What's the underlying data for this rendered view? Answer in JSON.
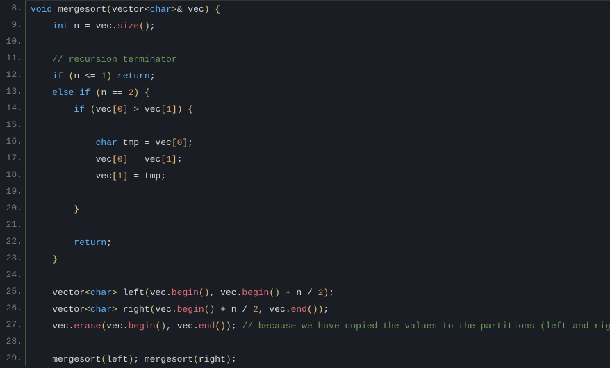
{
  "lines": [
    {
      "num": "8.",
      "tokens": [
        {
          "t": "void",
          "c": "blue"
        },
        {
          "t": " mergesort",
          "c": "plain"
        },
        {
          "t": "(",
          "c": "yellow"
        },
        {
          "t": "vector",
          "c": "plain"
        },
        {
          "t": "<",
          "c": "yellow"
        },
        {
          "t": "char",
          "c": "blue"
        },
        {
          "t": ">",
          "c": "yellow"
        },
        {
          "t": "& vec",
          "c": "plain"
        },
        {
          "t": ")",
          "c": "yellow"
        },
        {
          "t": " ",
          "c": "plain"
        },
        {
          "t": "{",
          "c": "yellow"
        }
      ]
    },
    {
      "num": "9.",
      "tokens": [
        {
          "t": "    ",
          "c": "plain"
        },
        {
          "t": "int",
          "c": "blue"
        },
        {
          "t": " n = vec.",
          "c": "plain"
        },
        {
          "t": "size",
          "c": "method"
        },
        {
          "t": "()",
          "c": "yellow"
        },
        {
          "t": ";",
          "c": "plain"
        }
      ]
    },
    {
      "num": "10.",
      "tokens": []
    },
    {
      "num": "11.",
      "tokens": [
        {
          "t": "    ",
          "c": "plain"
        },
        {
          "t": "// recursion terminator",
          "c": "comment"
        }
      ]
    },
    {
      "num": "12.",
      "tokens": [
        {
          "t": "    ",
          "c": "plain"
        },
        {
          "t": "if",
          "c": "blue"
        },
        {
          "t": " ",
          "c": "plain"
        },
        {
          "t": "(",
          "c": "yellow"
        },
        {
          "t": "n <= ",
          "c": "plain"
        },
        {
          "t": "1",
          "c": "orange"
        },
        {
          "t": ")",
          "c": "yellow"
        },
        {
          "t": " ",
          "c": "plain"
        },
        {
          "t": "return",
          "c": "blue"
        },
        {
          "t": ";",
          "c": "plain"
        }
      ]
    },
    {
      "num": "13.",
      "tokens": [
        {
          "t": "    ",
          "c": "plain"
        },
        {
          "t": "else",
          "c": "blue"
        },
        {
          "t": " ",
          "c": "plain"
        },
        {
          "t": "if",
          "c": "blue"
        },
        {
          "t": " ",
          "c": "plain"
        },
        {
          "t": "(",
          "c": "yellow"
        },
        {
          "t": "n == ",
          "c": "plain"
        },
        {
          "t": "2",
          "c": "orange"
        },
        {
          "t": ")",
          "c": "yellow"
        },
        {
          "t": " ",
          "c": "plain"
        },
        {
          "t": "{",
          "c": "yellow"
        }
      ]
    },
    {
      "num": "14.",
      "tokens": [
        {
          "t": "        ",
          "c": "plain"
        },
        {
          "t": "if",
          "c": "blue"
        },
        {
          "t": " ",
          "c": "plain"
        },
        {
          "t": "(",
          "c": "yellow"
        },
        {
          "t": "vec",
          "c": "plain"
        },
        {
          "t": "[",
          "c": "yellow"
        },
        {
          "t": "0",
          "c": "orange"
        },
        {
          "t": "]",
          "c": "yellow"
        },
        {
          "t": " > vec",
          "c": "plain"
        },
        {
          "t": "[",
          "c": "yellow"
        },
        {
          "t": "1",
          "c": "orange"
        },
        {
          "t": "])",
          "c": "yellow"
        },
        {
          "t": " ",
          "c": "plain"
        },
        {
          "t": "{",
          "c": "yellow"
        }
      ]
    },
    {
      "num": "15.",
      "tokens": []
    },
    {
      "num": "16.",
      "tokens": [
        {
          "t": "            ",
          "c": "plain"
        },
        {
          "t": "char",
          "c": "blue"
        },
        {
          "t": " tmp = vec",
          "c": "plain"
        },
        {
          "t": "[",
          "c": "yellow"
        },
        {
          "t": "0",
          "c": "orange"
        },
        {
          "t": "]",
          "c": "yellow"
        },
        {
          "t": ";",
          "c": "plain"
        }
      ]
    },
    {
      "num": "17.",
      "tokens": [
        {
          "t": "            vec",
          "c": "plain"
        },
        {
          "t": "[",
          "c": "yellow"
        },
        {
          "t": "0",
          "c": "orange"
        },
        {
          "t": "]",
          "c": "yellow"
        },
        {
          "t": " = vec",
          "c": "plain"
        },
        {
          "t": "[",
          "c": "yellow"
        },
        {
          "t": "1",
          "c": "orange"
        },
        {
          "t": "]",
          "c": "yellow"
        },
        {
          "t": ";",
          "c": "plain"
        }
      ]
    },
    {
      "num": "18.",
      "tokens": [
        {
          "t": "            vec",
          "c": "plain"
        },
        {
          "t": "[",
          "c": "yellow"
        },
        {
          "t": "1",
          "c": "orange"
        },
        {
          "t": "]",
          "c": "yellow"
        },
        {
          "t": " = tmp",
          "c": "plain"
        },
        {
          "t": ";",
          "c": "plain"
        }
      ]
    },
    {
      "num": "19.",
      "tokens": []
    },
    {
      "num": "20.",
      "tokens": [
        {
          "t": "        ",
          "c": "plain"
        },
        {
          "t": "}",
          "c": "yellow"
        }
      ]
    },
    {
      "num": "21.",
      "tokens": []
    },
    {
      "num": "22.",
      "tokens": [
        {
          "t": "        ",
          "c": "plain"
        },
        {
          "t": "return",
          "c": "blue"
        },
        {
          "t": ";",
          "c": "plain"
        }
      ]
    },
    {
      "num": "23.",
      "tokens": [
        {
          "t": "    ",
          "c": "plain"
        },
        {
          "t": "}",
          "c": "yellow"
        }
      ]
    },
    {
      "num": "24.",
      "tokens": []
    },
    {
      "num": "25.",
      "tokens": [
        {
          "t": "    vector",
          "c": "plain"
        },
        {
          "t": "<",
          "c": "yellow"
        },
        {
          "t": "char",
          "c": "blue"
        },
        {
          "t": ">",
          "c": "yellow"
        },
        {
          "t": " left",
          "c": "plain"
        },
        {
          "t": "(",
          "c": "yellow"
        },
        {
          "t": "vec.",
          "c": "plain"
        },
        {
          "t": "begin",
          "c": "method"
        },
        {
          "t": "()",
          "c": "yellow"
        },
        {
          "t": ", vec.",
          "c": "plain"
        },
        {
          "t": "begin",
          "c": "method"
        },
        {
          "t": "()",
          "c": "yellow"
        },
        {
          "t": " + n / ",
          "c": "plain"
        },
        {
          "t": "2",
          "c": "orange"
        },
        {
          "t": ")",
          "c": "yellow"
        },
        {
          "t": ";",
          "c": "plain"
        }
      ]
    },
    {
      "num": "26.",
      "tokens": [
        {
          "t": "    vector",
          "c": "plain"
        },
        {
          "t": "<",
          "c": "yellow"
        },
        {
          "t": "char",
          "c": "blue"
        },
        {
          "t": ">",
          "c": "yellow"
        },
        {
          "t": " right",
          "c": "plain"
        },
        {
          "t": "(",
          "c": "yellow"
        },
        {
          "t": "vec.",
          "c": "plain"
        },
        {
          "t": "begin",
          "c": "method"
        },
        {
          "t": "()",
          "c": "yellow"
        },
        {
          "t": " + n / ",
          "c": "plain"
        },
        {
          "t": "2",
          "c": "orange"
        },
        {
          "t": ", vec.",
          "c": "plain"
        },
        {
          "t": "end",
          "c": "method"
        },
        {
          "t": "())",
          "c": "yellow"
        },
        {
          "t": ";",
          "c": "plain"
        }
      ]
    },
    {
      "num": "27.",
      "tokens": [
        {
          "t": "    vec.",
          "c": "plain"
        },
        {
          "t": "erase",
          "c": "method"
        },
        {
          "t": "(",
          "c": "yellow"
        },
        {
          "t": "vec.",
          "c": "plain"
        },
        {
          "t": "begin",
          "c": "method"
        },
        {
          "t": "()",
          "c": "yellow"
        },
        {
          "t": ", vec.",
          "c": "plain"
        },
        {
          "t": "end",
          "c": "method"
        },
        {
          "t": "())",
          "c": "yellow"
        },
        {
          "t": "; ",
          "c": "plain"
        },
        {
          "t": "// because we have copied the values to the partitions (left and right)",
          "c": "comment"
        }
      ]
    },
    {
      "num": "28.",
      "tokens": []
    },
    {
      "num": "29.",
      "tokens": [
        {
          "t": "    mergesort",
          "c": "plain"
        },
        {
          "t": "(",
          "c": "yellow"
        },
        {
          "t": "left",
          "c": "plain"
        },
        {
          "t": ")",
          "c": "yellow"
        },
        {
          "t": "; mergesort",
          "c": "plain"
        },
        {
          "t": "(",
          "c": "yellow"
        },
        {
          "t": "right",
          "c": "plain"
        },
        {
          "t": ")",
          "c": "yellow"
        },
        {
          "t": ";",
          "c": "plain"
        }
      ]
    }
  ]
}
